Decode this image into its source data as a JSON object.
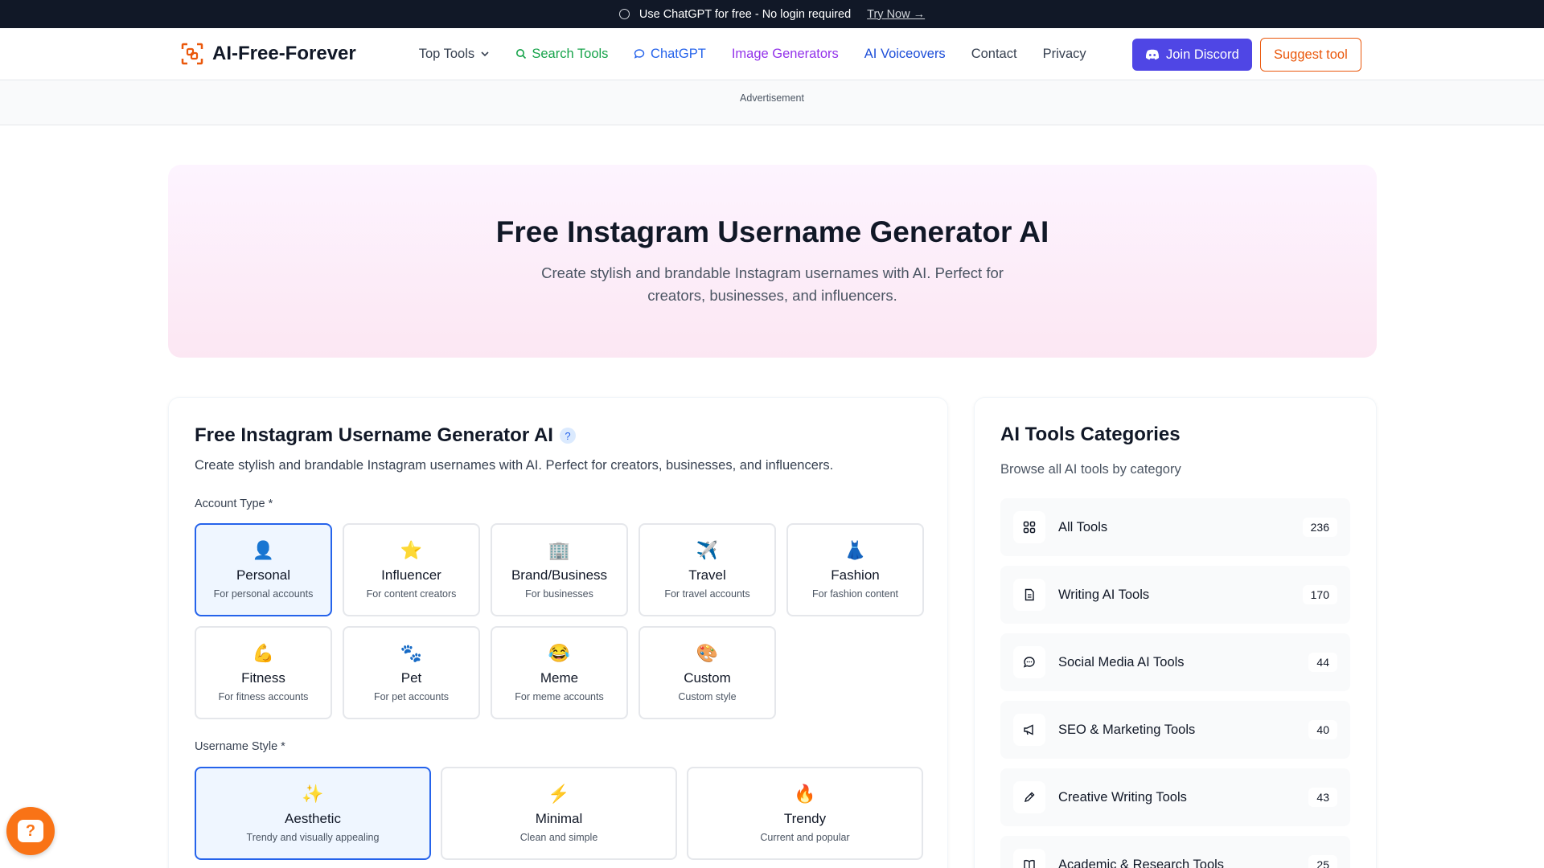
{
  "banner": {
    "text": "Use ChatGPT for free - No login required",
    "link": "Try Now →"
  },
  "header": {
    "logo": "AI-Free-Forever",
    "nav": [
      {
        "label": "Top Tools"
      },
      {
        "label": "Search Tools"
      },
      {
        "label": "ChatGPT"
      },
      {
        "label": "Image Generators"
      },
      {
        "label": "AI Voiceovers"
      },
      {
        "label": "Contact"
      },
      {
        "label": "Privacy"
      }
    ],
    "discord": "Join Discord",
    "suggest": "Suggest tool"
  },
  "ad": {
    "label": "Advertisement"
  },
  "hero": {
    "title": "Free Instagram Username Generator AI",
    "subtitle": "Create stylish and brandable Instagram usernames with AI. Perfect for creators, businesses, and influencers."
  },
  "tool": {
    "title": "Free Instagram Username Generator AI",
    "help": "?",
    "subtitle": "Create stylish and brandable Instagram usernames with AI. Perfect for creators, businesses, and influencers.",
    "account_label": "Account Type *",
    "account_types": [
      {
        "emoji": "👤",
        "title": "Personal",
        "desc": "For personal accounts"
      },
      {
        "emoji": "⭐",
        "title": "Influencer",
        "desc": "For content creators"
      },
      {
        "emoji": "🏢",
        "title": "Brand/Business",
        "desc": "For businesses"
      },
      {
        "emoji": "✈️",
        "title": "Travel",
        "desc": "For travel accounts"
      },
      {
        "emoji": "👗",
        "title": "Fashion",
        "desc": "For fashion content"
      },
      {
        "emoji": "💪",
        "title": "Fitness",
        "desc": "For fitness accounts"
      },
      {
        "emoji": "🐾",
        "title": "Pet",
        "desc": "For pet accounts"
      },
      {
        "emoji": "😂",
        "title": "Meme",
        "desc": "For meme accounts"
      },
      {
        "emoji": "🎨",
        "title": "Custom",
        "desc": "Custom style"
      }
    ],
    "style_label": "Username Style *",
    "styles": [
      {
        "emoji": "✨",
        "title": "Aesthetic",
        "desc": "Trendy and visually appealing"
      },
      {
        "emoji": "⚡",
        "title": "Minimal",
        "desc": "Clean and simple"
      },
      {
        "emoji": "🔥",
        "title": "Trendy",
        "desc": "Current and popular"
      }
    ]
  },
  "sidebar": {
    "title": "AI Tools Categories",
    "subtitle": "Browse all AI tools by category",
    "categories": [
      {
        "name": "All Tools",
        "count": "236",
        "icon": "grid-icon"
      },
      {
        "name": "Writing AI Tools",
        "count": "170",
        "icon": "document-icon"
      },
      {
        "name": "Social Media AI Tools",
        "count": "44",
        "icon": "chat-bubble-icon"
      },
      {
        "name": "SEO & Marketing Tools",
        "count": "40",
        "icon": "megaphone-icon"
      },
      {
        "name": "Creative Writing Tools",
        "count": "43",
        "icon": "pencil-icon"
      },
      {
        "name": "Academic & Research Tools",
        "count": "25",
        "icon": "book-icon"
      }
    ]
  },
  "colors": {
    "accent": "#4f46e5",
    "orange": "#ea580c",
    "selected_border": "#2563eb"
  }
}
